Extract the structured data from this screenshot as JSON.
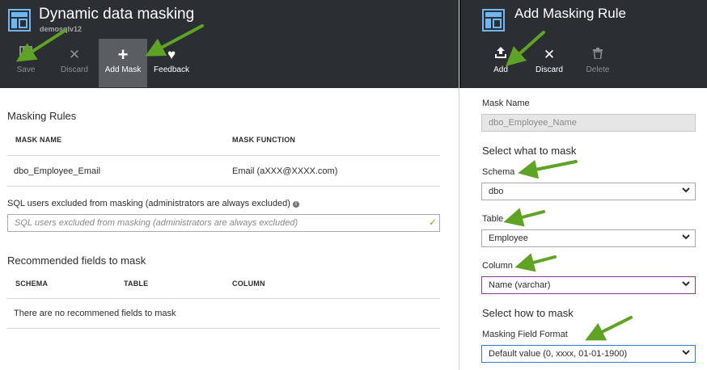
{
  "left_blade": {
    "title": "Dynamic data masking",
    "subtitle": "demosqlv12",
    "commands": [
      {
        "label": "Save",
        "icon": "save-icon",
        "glyph": "💾",
        "state": "disabled"
      },
      {
        "label": "Discard",
        "icon": "close-icon",
        "glyph": "✕",
        "state": "disabled"
      },
      {
        "label": "Add Mask",
        "icon": "plus-icon",
        "glyph": "+",
        "state": "active"
      },
      {
        "label": "Feedback",
        "icon": "heart-icon",
        "glyph": "♥",
        "state": "normal"
      }
    ],
    "masking_rules": {
      "heading": "Masking Rules",
      "columns": [
        "MASK NAME",
        "MASK FUNCTION"
      ],
      "rows": [
        {
          "name": "dbo_Employee_Email",
          "function": "Email (aXXX@XXXX.com)"
        }
      ]
    },
    "excluded_users": {
      "label": "SQL users excluded from masking (administrators are always excluded)",
      "info_glyph": "i",
      "placeholder": "SQL users excluded from masking (administrators are always excluded)",
      "check_glyph": "✓"
    },
    "recommended": {
      "heading": "Recommended fields to mask",
      "columns": [
        "SCHEMA",
        "TABLE",
        "COLUMN"
      ],
      "empty_text": "There are no recommened fields to mask"
    }
  },
  "right_blade": {
    "title": "Add Masking Rule",
    "commands": [
      {
        "label": "Add",
        "icon": "upload-icon",
        "glyph": "⇧",
        "state": "normal"
      },
      {
        "label": "Discard",
        "icon": "close-icon",
        "glyph": "✕",
        "state": "normal"
      },
      {
        "label": "Delete",
        "icon": "trash-icon",
        "glyph": "🗑",
        "state": "disabled"
      }
    ],
    "mask_name": {
      "label": "Mask Name",
      "value": "dbo_Employee_Name"
    },
    "select_what_heading": "Select what to mask",
    "schema": {
      "label": "Schema",
      "value": "dbo"
    },
    "table": {
      "label": "Table",
      "value": "Employee"
    },
    "column": {
      "label": "Column",
      "value": "Name (varchar)"
    },
    "select_how_heading": "Select how to mask",
    "format": {
      "label": "Masking Field Format",
      "value": "Default value (0, xxxx, 01-01-1900)"
    },
    "chevron": "⌄"
  },
  "colors": {
    "header_bg": "#2b2f33",
    "accent_blue": "#6fb7f0",
    "arrow_green": "#5fa324",
    "check_green": "#7cba00"
  }
}
